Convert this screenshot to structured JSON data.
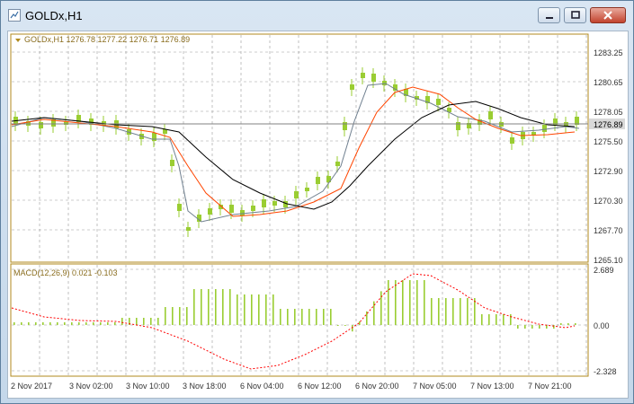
{
  "window": {
    "title": "GOLDx,H1",
    "controls": [
      "minimize",
      "maximize",
      "close"
    ]
  },
  "colors": {
    "frame": "#b08a1e",
    "grid": "#9a9a9a",
    "bull_candle": "#9acd32",
    "ma_fast": "#708090",
    "ma_mid": "#ff4500",
    "ma_slow": "#000000",
    "macd_hist": "#9acd32",
    "macd_signal": "#ff0000",
    "text": "#8a6d1e",
    "price_label_bg": "#d8d8d8"
  },
  "main_chart": {
    "header": "GOLDx,H1  1276.78 1277.22 1276.71 1276.89",
    "current_price_label": "1276.89",
    "price_labels": [
      "1283.25",
      "1280.65",
      "1278.05",
      "1275.50",
      "1272.90",
      "1270.30",
      "1267.70",
      "1265.10"
    ],
    "price_levels": [
      1283.25,
      1280.65,
      1278.05,
      1275.5,
      1272.9,
      1270.3,
      1267.7,
      1265.1
    ]
  },
  "indicator": {
    "header": "MACD(12,26,9) 0.021 -0.103",
    "labels": [
      "2.689",
      "0.00",
      "-2.328"
    ]
  },
  "time_axis": {
    "labels": [
      "2 Nov 2017",
      "3 Nov 02:00",
      "3 Nov 10:00",
      "3 Nov 18:00",
      "6 Nov 04:00",
      "6 Nov 12:00",
      "6 Nov 20:00",
      "7 Nov 05:00",
      "7 Nov 13:00",
      "7 Nov 21:00"
    ]
  }
}
